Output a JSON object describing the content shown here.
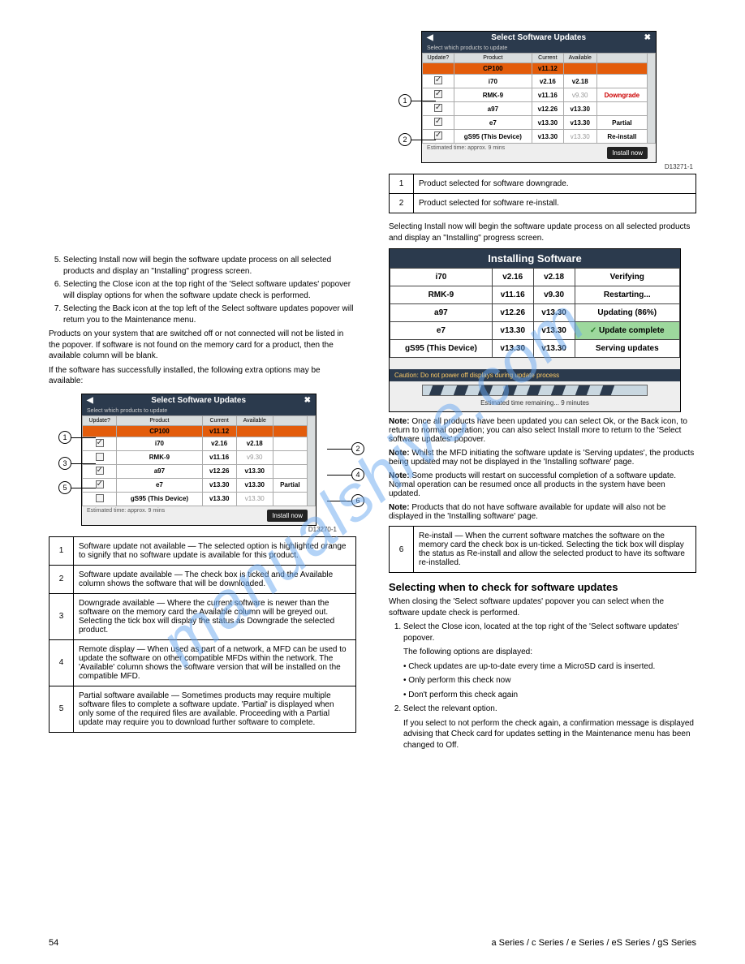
{
  "watermark": "manualshive.com",
  "dlg1": {
    "title": "Select Software Updates",
    "sub": "Select which products to update",
    "h": [
      "Update?",
      "Product",
      "Current",
      "Available",
      ""
    ],
    "rows": [
      {
        "chk": "none",
        "p": "CP100",
        "c": "v11.12",
        "a": "",
        "s": "",
        "cls": "orange-row"
      },
      {
        "chk": "on",
        "p": "i70",
        "c": "v2.16",
        "a": "v2.18",
        "s": ""
      },
      {
        "chk": "on",
        "p": "RMK-9",
        "c": "v11.16",
        "a": "v9.30",
        "s": "Downgrade",
        "ag": true,
        "sred": true
      },
      {
        "chk": "on",
        "p": "a97",
        "c": "v12.26",
        "a": "v13.30",
        "s": ""
      },
      {
        "chk": "on",
        "p": "e7",
        "c": "v13.30",
        "a": "v13.30",
        "s": "Partial"
      },
      {
        "chk": "on",
        "p": "gS95 (This Device)",
        "c": "v13.30",
        "a": "v13.30",
        "s": "Re-install",
        "ag": true
      }
    ],
    "callouts": [
      "1",
      "2"
    ],
    "est": "Estimated time: approx. 9 mins",
    "btn": "Install now",
    "ref": "D13271-1"
  },
  "legend1": {
    "rows": [
      {
        "n": "1",
        "t": "Product selected for software downgrade."
      },
      {
        "n": "2",
        "t": "Product selected for software re-install."
      }
    ]
  },
  "left_ol_intro": "",
  "left_ol": [
    "Selecting Install now will begin the software update process on all selected products and display an \"Installing\" progress screen.",
    "Selecting the Close icon at the top right of the 'Select software updates' popover will display options for when the software update check is performed.",
    "Selecting the Back icon at the top left of the Select software updates popover will return you to the Maintenance menu."
  ],
  "left_note": "Products on your system that are switched off or not connected will not be listed in the popover. If software is not found on the memory card for a product, then the available column will be blank.",
  "left_head": "If the software has successfully installed, the following extra options may be available:",
  "dlg2": {
    "title": "Select Software Updates",
    "sub": "Select which products to update",
    "h": [
      "Update?",
      "Product",
      "Current",
      "Available",
      ""
    ],
    "rows": [
      {
        "chk": "none",
        "p": "CP100",
        "c": "v11.12",
        "a": "",
        "s": "",
        "cls": "orange-row"
      },
      {
        "chk": "on",
        "p": "i70",
        "c": "v2.16",
        "a": "v2.18",
        "s": ""
      },
      {
        "chk": "off",
        "p": "RMK-9",
        "c": "v11.16",
        "a": "v9.30",
        "s": "",
        "ag": true
      },
      {
        "chk": "on",
        "p": "a97",
        "c": "v12.26",
        "a": "v13.30",
        "s": ""
      },
      {
        "chk": "on",
        "p": "e7",
        "c": "v13.30",
        "a": "v13.30",
        "s": "Partial"
      },
      {
        "chk": "off",
        "p": "gS95 (This Device)",
        "c": "v13.30",
        "a": "v13.30",
        "s": "",
        "ag": true
      }
    ],
    "callouts": [
      "1",
      "2",
      "3",
      "4",
      "5",
      "6"
    ],
    "est": "Estimated time: approx. 9 mins",
    "btn": "Install now",
    "ref": "D13270-1"
  },
  "legend2": {
    "rows": [
      {
        "n": "1",
        "t": "Software update not available — The selected option is highlighted orange to signify that no software update is available for this product."
      },
      {
        "n": "2",
        "t": "Software update available — The check box is ticked and the Available column shows the software that will be downloaded."
      },
      {
        "n": "3",
        "t": "Downgrade available — Where the current software is newer than the software on the memory card the Available column will be greyed out. Selecting the tick box will display the status as Downgrade the selected product."
      },
      {
        "n": "4",
        "t": "Remote display — When used as part of a network, a MFD can be used to update the software on other compatible MFDs within the network. The 'Available' column shows the software version that will be installed on the compatible MFD."
      },
      {
        "n": "5",
        "t": "Partial software available — Sometimes products may require multiple software files to complete a software update. 'Partial' is displayed when only some of the required files are available. Proceeding with a Partial update may require you to download further software to complete."
      }
    ]
  },
  "legend2b": {
    "n": "6",
    "t": "Re-install — When the current software matches the software on the memory card the check box is un-ticked. Selecting the tick box will display the status as Re-install and allow the selected product to have its software re-installed."
  },
  "right_p1": "Selecting Install now will begin the software update process on all selected products and display an \"Installing\" progress screen.",
  "install": {
    "title": "Installing Software",
    "rows": [
      {
        "p": "i70",
        "c": "v2.16",
        "a": "v2.18",
        "s": "Verifying"
      },
      {
        "p": "RMK-9",
        "c": "v11.16",
        "a": "v9.30",
        "s": "Restarting..."
      },
      {
        "p": "a97",
        "c": "v12.26",
        "a": "v13.30",
        "s": "Updating (86%)"
      },
      {
        "p": "e7",
        "c": "v13.30",
        "a": "v13.30",
        "s": "Update complete",
        "green": true
      },
      {
        "p": "gS95 (This Device)",
        "c": "v13.30",
        "a": "v13.30",
        "s": "Serving updates"
      }
    ],
    "caution": "Caution: Do not power off displays during update process",
    "est": "Estimated time remaining... 9 minutes"
  },
  "notes": [
    {
      "h": "Note:",
      "t": " Once all products have been updated you can select Ok, or the Back icon, to return to normal operation; you can also select Install more to return to the 'Select software updates' popover."
    },
    {
      "h": "Note:",
      "t": " Whilst the MFD initiating the software update is 'Serving updates', the products being updated may not be displayed in the 'Installing software' page."
    },
    {
      "h": "Note:",
      "t": " Some products will restart on successful completion of a software update. Normal operation can be resumed once all products in the system have been updated."
    },
    {
      "h": "Note:",
      "t": " Products that do not have software available for update will also not be displayed in the 'Installing software' page."
    }
  ],
  "right_head": "Selecting when to check for software updates",
  "right_lead": "When closing the 'Select software updates' popover you can select when the software update check is performed.",
  "right_ol": [
    "Select the Close icon, located at the top right of the 'Select software updates' popover.",
    "The following options are displayed:",
    "• Check updates are up-to-date every time a MicroSD card is inserted.",
    "• Only perform this check now",
    "• Don't perform this check again",
    "Select the relevant option.",
    "If you select to not perform the check again, a confirmation message is displayed advising that Check card for updates setting in the Maintenance menu has been changed to Off."
  ],
  "pagenum": "54",
  "footer": "a Series / c Series / e Series / eS Series / gS Series"
}
